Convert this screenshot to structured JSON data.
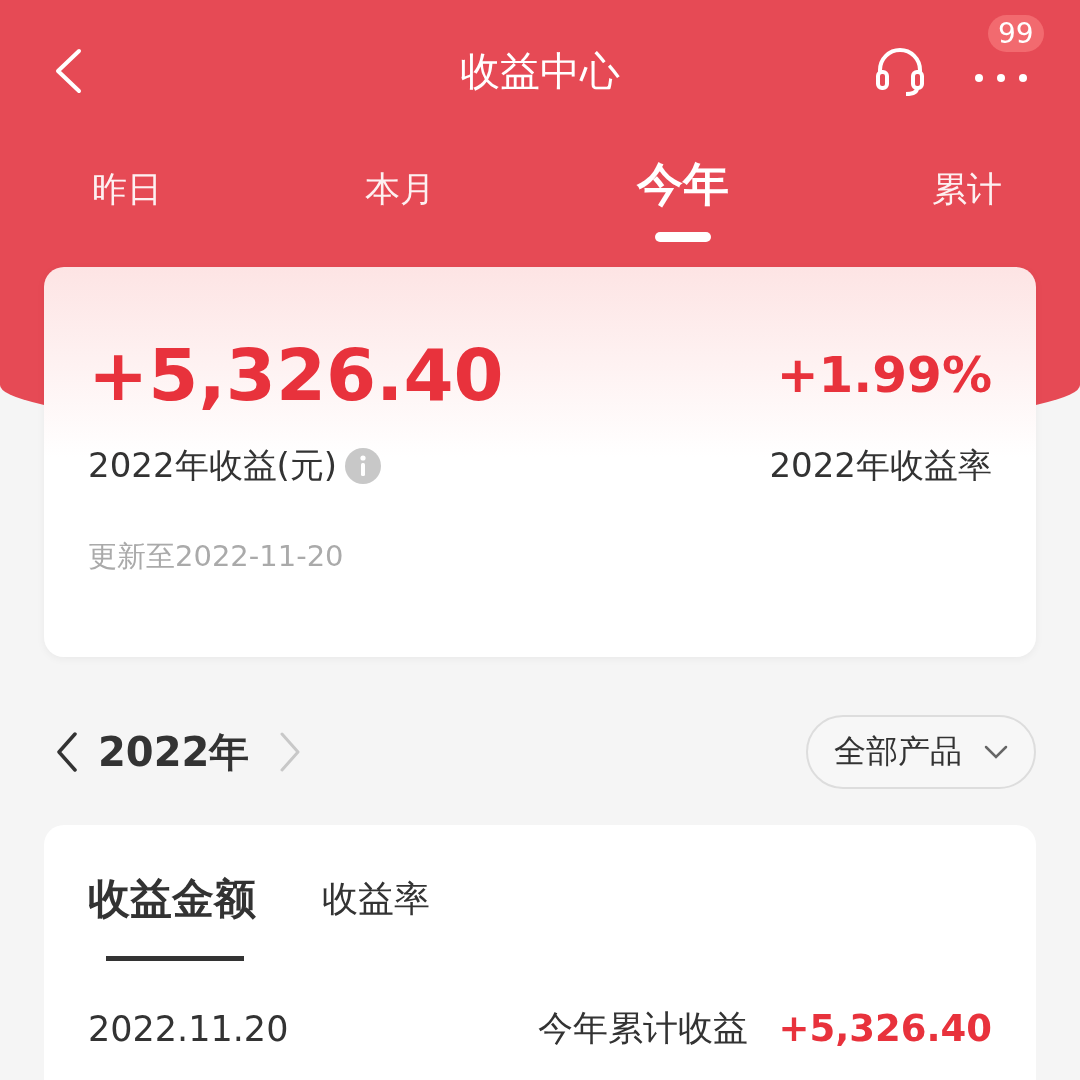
{
  "header": {
    "title": "收益中心",
    "badge": "99"
  },
  "tabs": [
    {
      "label": "昨日",
      "selected": false
    },
    {
      "label": "本月",
      "selected": false
    },
    {
      "label": "今年",
      "selected": true
    },
    {
      "label": "累计",
      "selected": false
    }
  ],
  "summary": {
    "amount": "+5,326.40",
    "rate": "+1.99%",
    "amount_label": "2022年收益(元)",
    "rate_label": "2022年收益率",
    "updated": "更新至2022-11-20"
  },
  "year_nav": {
    "year": "2022年",
    "filter": "全部产品"
  },
  "detail_tabs": [
    {
      "label": "收益金额",
      "selected": true
    },
    {
      "label": "收益率",
      "selected": false
    }
  ],
  "rows": [
    {
      "date": "2022.11.20",
      "label": "今年累计收益",
      "value": "+5,326.40"
    }
  ]
}
